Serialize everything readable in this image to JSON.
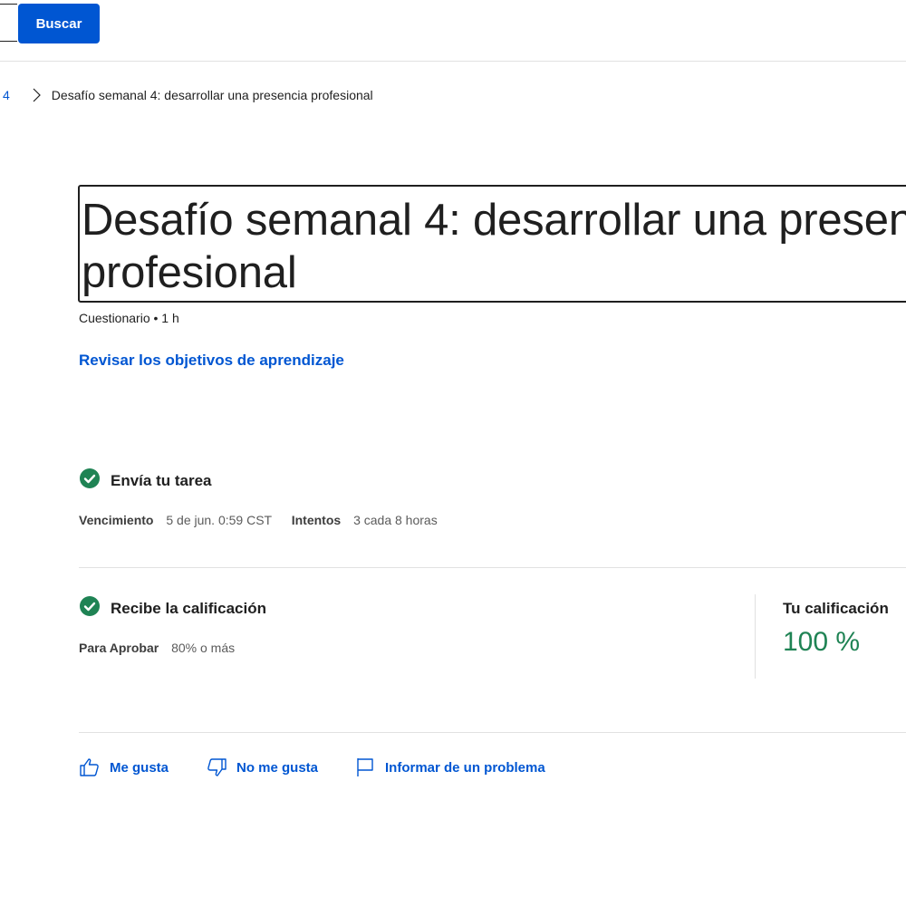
{
  "header": {
    "search_button_label": "Buscar"
  },
  "breadcrumb": {
    "prev_label": "4",
    "current_label": "Desafío semanal 4: desarrollar una presencia profesional"
  },
  "assignment": {
    "title": "Desafío semanal 4: desarrollar una presencia profesional",
    "meta": "Cuestionario • 1 h",
    "objectives_link": "Revisar los objetivos de aprendizaje"
  },
  "submit_section": {
    "title": "Envía tu tarea",
    "due_label": "Vencimiento",
    "due_value": "5 de jun. 0:59 CST",
    "attempts_label": "Intentos",
    "attempts_value": "3 cada 8 horas"
  },
  "grade_section": {
    "title": "Recibe la calificación",
    "pass_label": "Para Aprobar",
    "pass_value": "80% o más",
    "your_grade_label": "Tu calificación",
    "your_grade_value": "100 %"
  },
  "feedback": {
    "like_label": "Me gusta",
    "dislike_label": "No me gusta",
    "report_label": "Informar de un problema"
  },
  "colors": {
    "brand_blue": "#0056d2",
    "success_green": "#1f8354",
    "text": "#1f1f1f"
  },
  "icons": {
    "breadcrumb_separator": "chevron-right-icon",
    "check": "check-circle-icon",
    "like": "thumbs-up-icon",
    "dislike": "thumbs-down-icon",
    "report": "flag-icon"
  }
}
